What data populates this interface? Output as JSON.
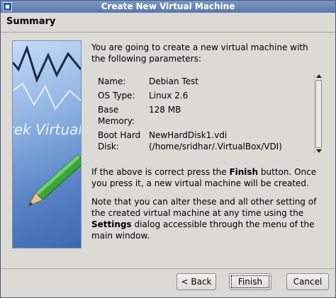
{
  "window": {
    "title": "Create New Virtual Machine"
  },
  "header": {
    "title": "Summary"
  },
  "graphic": {
    "text": "tek Virtual"
  },
  "summary": {
    "intro": "You are going to create a new virtual machine with the following parameters:",
    "params": [
      {
        "label": "Name:",
        "value": "Debian Test"
      },
      {
        "label": "OS Type:",
        "value": "Linux 2.6"
      },
      {
        "label": "Base Memory:",
        "value": "128 MB"
      },
      {
        "label": "Boot Hard Disk:",
        "value": "NewHardDisk1.vdi (/home/sridhar/.VirtualBox/VDI)"
      }
    ],
    "finish_note_prefix": "If the above is correct press the ",
    "finish_note_bold": "Finish",
    "finish_note_suffix": " button. Once you press it, a new virtual machine will be created.",
    "settings_note_prefix": "Note that you can alter these and all other setting of the created virtual machine at any time using the ",
    "settings_note_bold": "Settings",
    "settings_note_suffix": " dialog accessible through the menu of the main window."
  },
  "buttons": {
    "back": "< Back",
    "finish": "Finish",
    "cancel": "Cancel"
  },
  "colors": {
    "titlebar": "#5a78ad",
    "window_bg": "#dcdad5"
  }
}
